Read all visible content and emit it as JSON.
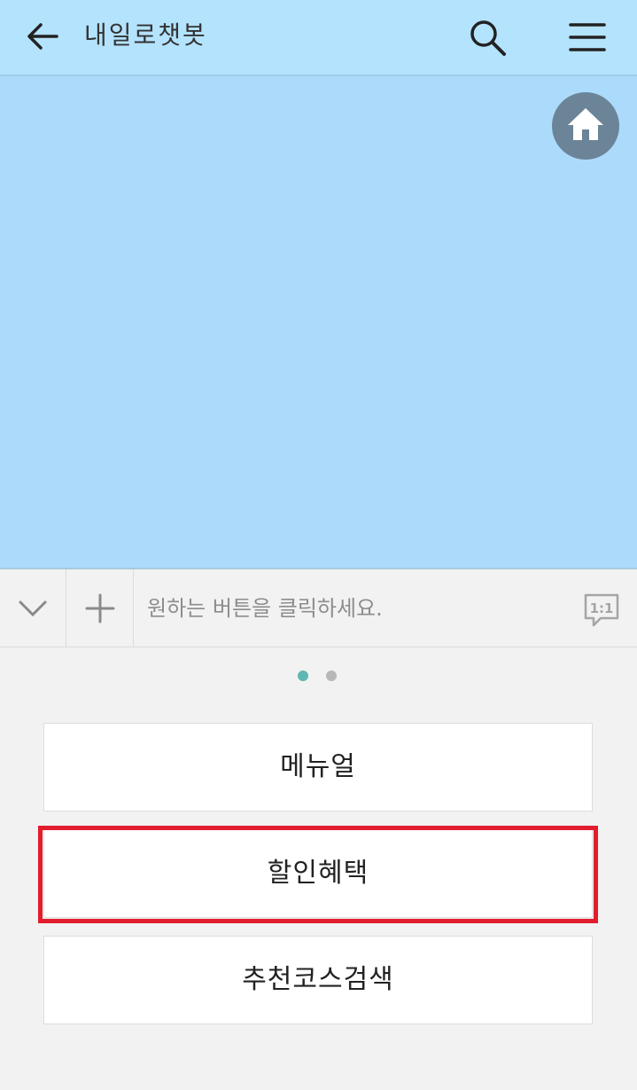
{
  "header": {
    "title": "내일로챗봇",
    "back_icon": "back-arrow-icon",
    "search_icon": "search-icon",
    "menu_icon": "hamburger-menu-icon",
    "background_color": "#b4e3fd"
  },
  "chat": {
    "background_color": "#acdafa",
    "home_icon": "home-icon"
  },
  "input_bar": {
    "collapse_icon": "chevron-down-icon",
    "add_icon": "plus-icon",
    "placeholder": "원하는 버튼을 클릭하세요.",
    "one_to_one_icon": "one-to-one-chat-icon",
    "one_to_one_label": "1:1"
  },
  "pager": {
    "page_count": 2,
    "active_page": 1,
    "active_color": "#5fb7b2",
    "inactive_color": "#b8b8b8"
  },
  "options": [
    {
      "label": "메뉴얼"
    },
    {
      "label": "할인혜택",
      "highlighted": true
    },
    {
      "label": "추천코스검색"
    }
  ],
  "highlight_color": "#e21d2d"
}
